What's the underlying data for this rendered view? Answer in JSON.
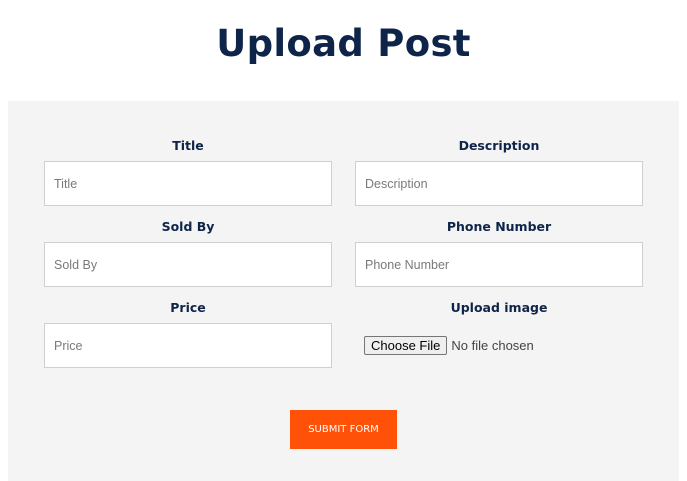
{
  "page": {
    "title": "Upload Post"
  },
  "form": {
    "title": {
      "label": "Title",
      "placeholder": "Title",
      "value": ""
    },
    "description": {
      "label": "Description",
      "placeholder": "Description",
      "value": ""
    },
    "sold_by": {
      "label": "Sold By",
      "placeholder": "Sold By",
      "value": ""
    },
    "phone_number": {
      "label": "Phone Number",
      "placeholder": "Phone Number",
      "value": ""
    },
    "price": {
      "label": "Price",
      "placeholder": "Price",
      "value": ""
    },
    "upload_image": {
      "label": "Upload image",
      "button_label": "Choose File",
      "status_text": "No file chosen"
    },
    "submit_label": "SUBMIT FORM"
  },
  "colors": {
    "title": "#0e2448",
    "panel_background": "#f4f4f4",
    "submit_background": "#ff5107",
    "submit_text": "#ffffff"
  }
}
